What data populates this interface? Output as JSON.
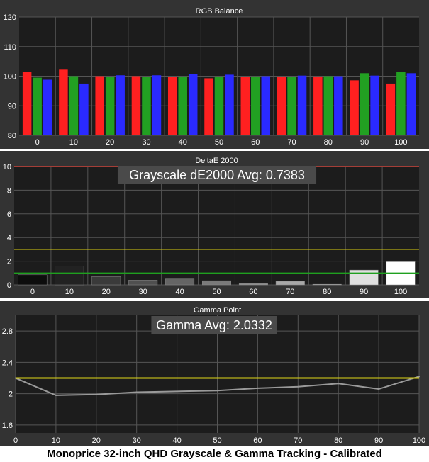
{
  "caption": "Monoprice 32-inch QHD Grayscale & Gamma Tracking - Calibrated",
  "chart_data": [
    {
      "type": "bar",
      "title": "RGB Balance",
      "categories": [
        "0",
        "10",
        "20",
        "30",
        "40",
        "50",
        "60",
        "70",
        "80",
        "90",
        "100"
      ],
      "ylim": [
        80,
        120
      ],
      "yticks": [
        "80",
        "90",
        "100",
        "110",
        "120"
      ],
      "grid": true,
      "series": [
        {
          "color": "#ff2020",
          "values": [
            101.5,
            102.2,
            100.0,
            100.0,
            99.7,
            99.3,
            99.7,
            99.9,
            99.9,
            98.6,
            97.5
          ]
        },
        {
          "color": "#22a022",
          "values": [
            99.5,
            100.0,
            99.7,
            99.7,
            99.9,
            99.9,
            99.9,
            99.8,
            100.0,
            101.0,
            101.5
          ]
        },
        {
          "color": "#2a2aff",
          "values": [
            98.8,
            97.5,
            100.3,
            100.3,
            100.6,
            100.5,
            100.0,
            100.2,
            100.0,
            100.2,
            101.0
          ]
        }
      ]
    },
    {
      "type": "bar",
      "title": "DeltaE 2000",
      "annotation": "Grayscale dE2000 Avg: 0.7383",
      "categories": [
        "0",
        "10",
        "20",
        "30",
        "40",
        "50",
        "60",
        "70",
        "80",
        "90",
        "100"
      ],
      "values": [
        0.85,
        1.6,
        0.7,
        0.4,
        0.5,
        0.35,
        0.1,
        0.3,
        0.05,
        1.25,
        1.95
      ],
      "bar_colors": [
        "#0d0d0d",
        "#222222",
        "#3a3a3a",
        "#505050",
        "#656565",
        "#7a7a7a",
        "#909090",
        "#a8a8a8",
        "#c0c0c0",
        "#e0e0e0",
        "#ffffff"
      ],
      "ylim": [
        0,
        10
      ],
      "yticks": [
        "0",
        "2",
        "4",
        "6",
        "8",
        "10"
      ],
      "reference_lines": [
        {
          "value": 10,
          "color": "#e8463a"
        },
        {
          "value": 3,
          "color": "#d8cc10"
        },
        {
          "value": 1,
          "color": "#1fa01f"
        }
      ],
      "grid": true
    },
    {
      "type": "line",
      "title": "Gamma Point",
      "annotation": "Gamma Avg: 2.0332",
      "x": [
        0,
        10,
        20,
        30,
        40,
        50,
        60,
        70,
        80,
        90,
        100
      ],
      "xticks": [
        "0",
        "10",
        "20",
        "30",
        "40",
        "50",
        "60",
        "70",
        "80",
        "90",
        "100"
      ],
      "y": [
        2.2,
        1.98,
        1.99,
        2.02,
        2.03,
        2.04,
        2.07,
        2.09,
        2.13,
        2.06,
        2.22
      ],
      "ylim": [
        1.5,
        3.0
      ],
      "yticks": [
        "1.6",
        "2",
        "2.4",
        "2.8"
      ],
      "reference_lines": [
        {
          "value": 2.2,
          "color": "#e0d818"
        }
      ],
      "grid": true
    }
  ]
}
